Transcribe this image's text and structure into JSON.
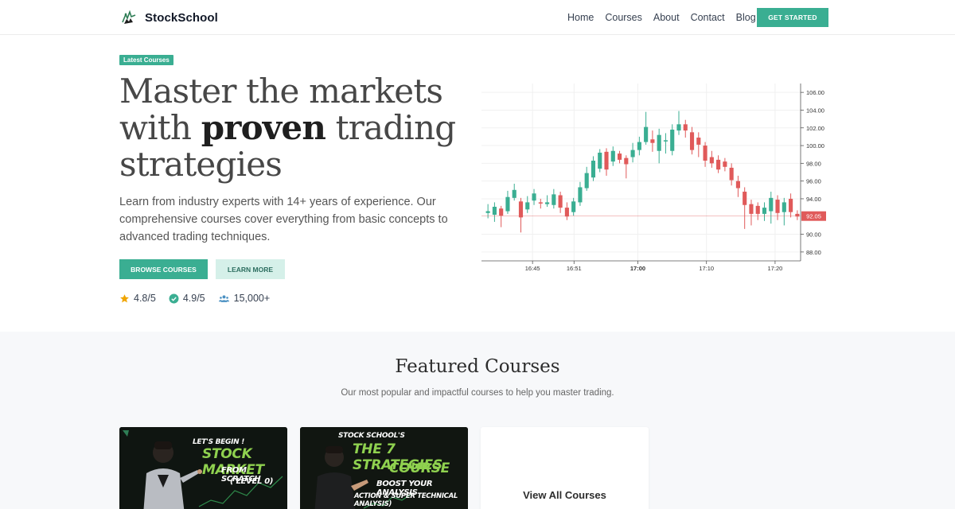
{
  "brand": {
    "name": "StockSchool",
    "logo_icon": "bull-icon"
  },
  "nav": {
    "links": [
      "Home",
      "Courses",
      "About",
      "Contact",
      "Blog"
    ],
    "cta_label": "GET STARTED"
  },
  "hero": {
    "badge": "Latest Courses",
    "headline_line1": "Master the markets",
    "headline_line2_a": "with",
    "headline_line2_b": "proven",
    "headline_line2_c": "trading",
    "headline_line3": "strategies",
    "lead": "Learn from industry experts with 14+ years of experience. Our comprehensive courses cover everything from basic concepts to advanced trading techniques.",
    "primary_button": "BROWSE COURSES",
    "secondary_button": "LEARN MORE",
    "stats": [
      {
        "icon": "star-icon",
        "value": "4.8/5"
      },
      {
        "icon": "check-circle-icon",
        "value": "4.9/5"
      },
      {
        "icon": "users-icon",
        "value": "15,000+"
      }
    ]
  },
  "chart_data": {
    "type": "candlestick",
    "y_ticks": [
      "106.00",
      "104.00",
      "102.00",
      "100.00",
      "98.00",
      "96.00",
      "94.00",
      "90.00",
      "88.00"
    ],
    "ylim": [
      87,
      107
    ],
    "x_ticks": [
      "16:45",
      "16:51",
      "17:00",
      "17:10",
      "17:20"
    ],
    "current_price": "92.05",
    "colors": {
      "up": "#3aae92",
      "down": "#e05a5a",
      "price_tag": "#e05a5a"
    },
    "candles": [
      {
        "o": 92.4,
        "c": 92.6,
        "h": 93.4,
        "l": 91.8
      },
      {
        "o": 92.2,
        "c": 93.1,
        "h": 93.6,
        "l": 91.4
      },
      {
        "o": 92.9,
        "c": 92.1,
        "h": 93.2,
        "l": 90.8
      },
      {
        "o": 92.6,
        "c": 94.2,
        "h": 94.9,
        "l": 92.3
      },
      {
        "o": 94.1,
        "c": 95.0,
        "h": 95.7,
        "l": 93.8
      },
      {
        "o": 93.7,
        "c": 91.9,
        "h": 94.1,
        "l": 90.2
      },
      {
        "o": 92.8,
        "c": 93.6,
        "h": 94.3,
        "l": 92.4
      },
      {
        "o": 93.8,
        "c": 94.6,
        "h": 95.1,
        "l": 93.3
      },
      {
        "o": 93.6,
        "c": 93.5,
        "h": 94.0,
        "l": 92.9
      },
      {
        "o": 93.4,
        "c": 93.6,
        "h": 94.4,
        "l": 93.1
      },
      {
        "o": 93.3,
        "c": 94.5,
        "h": 95.1,
        "l": 92.9
      },
      {
        "o": 94.4,
        "c": 93.0,
        "h": 94.8,
        "l": 92.4
      },
      {
        "o": 93.0,
        "c": 92.0,
        "h": 93.6,
        "l": 91.6
      },
      {
        "o": 92.5,
        "c": 93.7,
        "h": 94.1,
        "l": 92.1
      },
      {
        "o": 93.6,
        "c": 95.3,
        "h": 95.9,
        "l": 93.2
      },
      {
        "o": 95.2,
        "c": 96.9,
        "h": 97.6,
        "l": 94.9
      },
      {
        "o": 96.4,
        "c": 98.3,
        "h": 98.8,
        "l": 96.0
      },
      {
        "o": 97.4,
        "c": 99.2,
        "h": 99.6,
        "l": 97.0
      },
      {
        "o": 99.3,
        "c": 97.3,
        "h": 99.7,
        "l": 96.6
      },
      {
        "o": 98.2,
        "c": 99.4,
        "h": 99.9,
        "l": 97.7
      },
      {
        "o": 99.1,
        "c": 98.4,
        "h": 99.4,
        "l": 98.0
      },
      {
        "o": 98.6,
        "c": 97.9,
        "h": 98.9,
        "l": 96.3
      },
      {
        "o": 98.7,
        "c": 99.5,
        "h": 100.3,
        "l": 98.1
      },
      {
        "o": 99.5,
        "c": 100.4,
        "h": 101.0,
        "l": 98.9
      },
      {
        "o": 100.4,
        "c": 102.1,
        "h": 103.8,
        "l": 100.1
      },
      {
        "o": 100.7,
        "c": 100.3,
        "h": 101.7,
        "l": 99.3
      },
      {
        "o": 99.4,
        "c": 101.2,
        "h": 101.9,
        "l": 98.0
      },
      {
        "o": 100.5,
        "c": 100.6,
        "h": 101.4,
        "l": 99.1
      },
      {
        "o": 99.4,
        "c": 101.8,
        "h": 102.4,
        "l": 98.9
      },
      {
        "o": 101.7,
        "c": 102.4,
        "h": 103.9,
        "l": 101.2
      },
      {
        "o": 102.4,
        "c": 101.7,
        "h": 102.9,
        "l": 100.9
      },
      {
        "o": 101.5,
        "c": 99.5,
        "h": 102.1,
        "l": 99.0
      },
      {
        "o": 100.9,
        "c": 100.1,
        "h": 101.5,
        "l": 98.7
      },
      {
        "o": 100.0,
        "c": 98.3,
        "h": 100.4,
        "l": 97.6
      },
      {
        "o": 98.7,
        "c": 98.0,
        "h": 99.4,
        "l": 97.5
      },
      {
        "o": 98.4,
        "c": 97.3,
        "h": 98.9,
        "l": 96.9
      },
      {
        "o": 98.2,
        "c": 97.6,
        "h": 98.6,
        "l": 97.1
      },
      {
        "o": 97.5,
        "c": 96.1,
        "h": 98.0,
        "l": 95.5
      },
      {
        "o": 96.0,
        "c": 95.2,
        "h": 96.6,
        "l": 94.2
      },
      {
        "o": 94.8,
        "c": 93.3,
        "h": 95.3,
        "l": 90.6
      },
      {
        "o": 93.4,
        "c": 92.3,
        "h": 93.9,
        "l": 91.0
      },
      {
        "o": 93.2,
        "c": 92.3,
        "h": 93.6,
        "l": 91.6
      },
      {
        "o": 92.3,
        "c": 93.0,
        "h": 93.6,
        "l": 91.5
      },
      {
        "o": 92.6,
        "c": 94.1,
        "h": 94.8,
        "l": 91.2
      },
      {
        "o": 93.9,
        "c": 92.4,
        "h": 94.4,
        "l": 91.6
      },
      {
        "o": 92.5,
        "c": 93.6,
        "h": 94.1,
        "l": 91.0
      },
      {
        "o": 94.0,
        "c": 92.5,
        "h": 94.6,
        "l": 91.9
      },
      {
        "o": 92.3,
        "c": 92.0,
        "h": 92.7,
        "l": 91.6
      }
    ]
  },
  "featured": {
    "title": "Featured Courses",
    "subtitle": "Our most popular and impactful courses to help you master trading.",
    "cards": [
      {
        "line1": "LET'S BEGIN !",
        "line2": "STOCK MARKET",
        "line3": "FROM SCRATCH",
        "line4": "( LEVEL 0)"
      },
      {
        "line1": "STOCK SCHOOL'S",
        "line2": "THE 7 STRATEGIES",
        "line3": "COURSE",
        "line4": "BOOST YOUR ANALYSIS",
        "line5": "ACTION & SUPER TECHNICAL ANALYSIS)"
      }
    ],
    "view_all_label": "View All Courses"
  }
}
